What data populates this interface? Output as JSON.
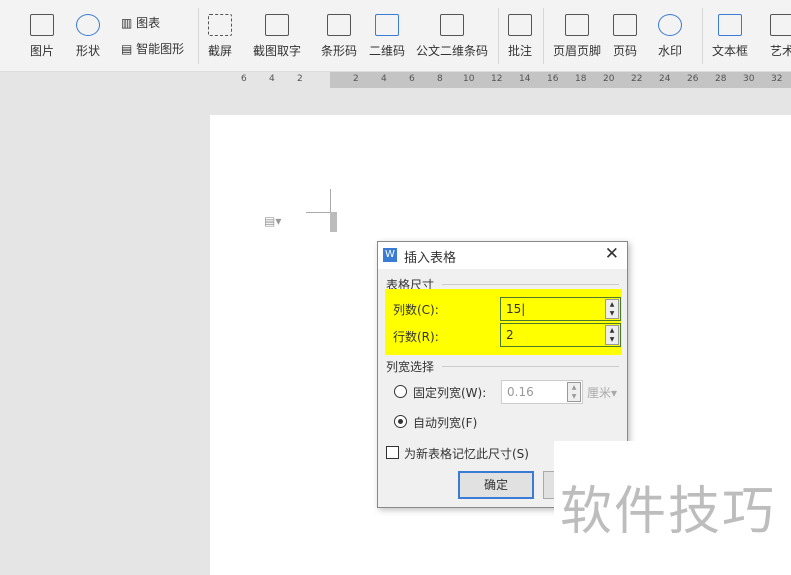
{
  "toolbar": {
    "picture": "图片",
    "shape": "形状",
    "chart": "图表",
    "smartart": "智能图形",
    "screenshot": "截屏",
    "ocr": "截图取字",
    "barcode": "条形码",
    "qrcode": "二维码",
    "doc_qr": "公文二维条码",
    "comment": "批注",
    "header_footer": "页眉页脚",
    "page_number": "页码",
    "watermark": "水印",
    "textbox": "文本框",
    "art": "艺术"
  },
  "ruler": [
    "6",
    "4",
    "2",
    "2",
    "4",
    "6",
    "8",
    "10",
    "12",
    "14",
    "16",
    "18",
    "20",
    "22",
    "24",
    "26",
    "28",
    "30",
    "32"
  ],
  "dialog": {
    "title": "插入表格",
    "close": "✕",
    "size_group": "表格尺寸",
    "cols_label": "列数(C):",
    "cols_value": "15",
    "rows_label": "行数(R):",
    "rows_value": "2",
    "width_group": "列宽选择",
    "fixed_label": "固定列宽(W):",
    "fixed_value": "0.16",
    "unit": "厘米",
    "auto_label": "自动列宽(F)",
    "remember_label": "为新表格记忆此尺寸(S)",
    "ok": "确定"
  },
  "watermark_text": "软件技巧"
}
